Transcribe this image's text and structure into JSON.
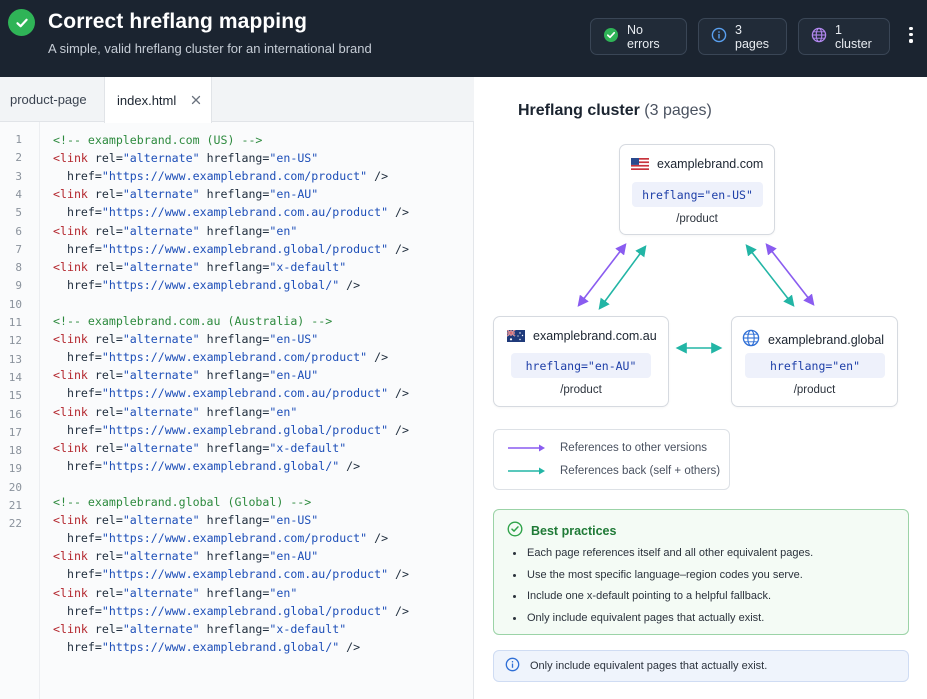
{
  "header": {
    "title": "Correct hreflang mapping",
    "subtitle": "A simple, valid hreflang cluster for an international brand",
    "badges": [
      {
        "label": "No errors",
        "icon": "check-circle-icon",
        "color": "#2fb457"
      },
      {
        "label": "3 pages",
        "icon": "info-icon",
        "color": "#5aa0f0"
      },
      {
        "label": "1 cluster",
        "icon": "globe-icon",
        "color": "#b388f0"
      }
    ]
  },
  "editor": {
    "tabs": [
      {
        "label": "product-page"
      },
      {
        "label": "index.html",
        "active": true
      }
    ],
    "line_numbers": [
      "1",
      "2",
      "3",
      "4",
      "5",
      "6",
      "7",
      "8",
      "9",
      "10",
      "11",
      "12",
      "13",
      "14",
      "15",
      "16",
      "17",
      "18",
      "19",
      "20",
      "21",
      "22"
    ],
    "lines": [
      [
        {
          "t": "<!-- examplebrand.com (US) -->",
          "c": "cm"
        }
      ],
      [
        {
          "t": "<link ",
          "c": "tg"
        },
        {
          "t": "rel=",
          "c": "at"
        },
        {
          "t": "\"alternate\"",
          "c": "st"
        },
        {
          "t": " hreflang=",
          "c": "at"
        },
        {
          "t": "\"en-US\"",
          "c": "st"
        }
      ],
      [
        {
          "t": "  href=",
          "c": "at"
        },
        {
          "t": "\"https://www.examplebrand.com/product\"",
          "c": "st"
        },
        {
          "t": " />",
          "c": "at"
        }
      ],
      [
        {
          "t": "<link ",
          "c": "tg"
        },
        {
          "t": "rel=",
          "c": "at"
        },
        {
          "t": "\"alternate\"",
          "c": "st"
        },
        {
          "t": " hreflang=",
          "c": "at"
        },
        {
          "t": "\"en-AU\"",
          "c": "st"
        }
      ],
      [
        {
          "t": "  href=",
          "c": "at"
        },
        {
          "t": "\"https://www.examplebrand.com.au/product\"",
          "c": "st"
        },
        {
          "t": " />",
          "c": "at"
        }
      ],
      [
        {
          "t": "<link ",
          "c": "tg"
        },
        {
          "t": "rel=",
          "c": "at"
        },
        {
          "t": "\"alternate\"",
          "c": "st"
        },
        {
          "t": " hreflang=",
          "c": "at"
        },
        {
          "t": "\"en\"",
          "c": "st"
        }
      ],
      [
        {
          "t": "  href=",
          "c": "at"
        },
        {
          "t": "\"https://www.examplebrand.global/product\"",
          "c": "st"
        },
        {
          "t": " />",
          "c": "at"
        }
      ],
      [
        {
          "t": "<link ",
          "c": "tg"
        },
        {
          "t": "rel=",
          "c": "at"
        },
        {
          "t": "\"alternate\"",
          "c": "st"
        },
        {
          "t": " hreflang=",
          "c": "at"
        },
        {
          "t": "\"x-default\"",
          "c": "st"
        }
      ],
      [
        {
          "t": "  href=",
          "c": "at"
        },
        {
          "t": "\"https://www.examplebrand.global/\"",
          "c": "st"
        },
        {
          "t": " />",
          "c": "at"
        }
      ],
      [],
      [
        {
          "t": "<!-- examplebrand.com.au (Australia) -->",
          "c": "cm"
        }
      ],
      [
        {
          "t": "<link ",
          "c": "tg"
        },
        {
          "t": "rel=",
          "c": "at"
        },
        {
          "t": "\"alternate\"",
          "c": "st"
        },
        {
          "t": " hreflang=",
          "c": "at"
        },
        {
          "t": "\"en-US\"",
          "c": "st"
        }
      ],
      [
        {
          "t": "  href=",
          "c": "at"
        },
        {
          "t": "\"https://www.examplebrand.com/product\"",
          "c": "st"
        },
        {
          "t": " />",
          "c": "at"
        }
      ],
      [
        {
          "t": "<link ",
          "c": "tg"
        },
        {
          "t": "rel=",
          "c": "at"
        },
        {
          "t": "\"alternate\"",
          "c": "st"
        },
        {
          "t": " hreflang=",
          "c": "at"
        },
        {
          "t": "\"en-AU\"",
          "c": "st"
        }
      ],
      [
        {
          "t": "  href=",
          "c": "at"
        },
        {
          "t": "\"https://www.examplebrand.com.au/product\"",
          "c": "st"
        },
        {
          "t": " />",
          "c": "at"
        }
      ],
      [
        {
          "t": "<link ",
          "c": "tg"
        },
        {
          "t": "rel=",
          "c": "at"
        },
        {
          "t": "\"alternate\"",
          "c": "st"
        },
        {
          "t": " hreflang=",
          "c": "at"
        },
        {
          "t": "\"en\"",
          "c": "st"
        }
      ],
      [
        {
          "t": "  href=",
          "c": "at"
        },
        {
          "t": "\"https://www.examplebrand.global/product\"",
          "c": "st"
        },
        {
          "t": " />",
          "c": "at"
        }
      ],
      [
        {
          "t": "<link ",
          "c": "tg"
        },
        {
          "t": "rel=",
          "c": "at"
        },
        {
          "t": "\"alternate\"",
          "c": "st"
        },
        {
          "t": " hreflang=",
          "c": "at"
        },
        {
          "t": "\"x-default\"",
          "c": "st"
        }
      ],
      [
        {
          "t": "  href=",
          "c": "at"
        },
        {
          "t": "\"https://www.examplebrand.global/\"",
          "c": "st"
        },
        {
          "t": " />",
          "c": "at"
        }
      ],
      [],
      [
        {
          "t": "<!-- examplebrand.global (Global) -->",
          "c": "cm"
        }
      ],
      [
        {
          "t": "<link ",
          "c": "tg"
        },
        {
          "t": "rel=",
          "c": "at"
        },
        {
          "t": "\"alternate\"",
          "c": "st"
        },
        {
          "t": " hreflang=",
          "c": "at"
        },
        {
          "t": "\"en-US\"",
          "c": "st"
        }
      ],
      [
        {
          "t": "  href=",
          "c": "at"
        },
        {
          "t": "\"https://www.examplebrand.com/product\"",
          "c": "st"
        },
        {
          "t": " />",
          "c": "at"
        }
      ],
      [
        {
          "t": "<link ",
          "c": "tg"
        },
        {
          "t": "rel=",
          "c": "at"
        },
        {
          "t": "\"alternate\"",
          "c": "st"
        },
        {
          "t": " hreflang=",
          "c": "at"
        },
        {
          "t": "\"en-AU\"",
          "c": "st"
        }
      ],
      [
        {
          "t": "  href=",
          "c": "at"
        },
        {
          "t": "\"https://www.examplebrand.com.au/product\"",
          "c": "st"
        },
        {
          "t": " />",
          "c": "at"
        }
      ],
      [
        {
          "t": "<link ",
          "c": "tg"
        },
        {
          "t": "rel=",
          "c": "at"
        },
        {
          "t": "\"alternate\"",
          "c": "st"
        },
        {
          "t": " hreflang=",
          "c": "at"
        },
        {
          "t": "\"en\"",
          "c": "st"
        }
      ],
      [
        {
          "t": "  href=",
          "c": "at"
        },
        {
          "t": "\"https://www.examplebrand.global/product\"",
          "c": "st"
        },
        {
          "t": " />",
          "c": "at"
        }
      ],
      [
        {
          "t": "<link ",
          "c": "tg"
        },
        {
          "t": "rel=",
          "c": "at"
        },
        {
          "t": "\"alternate\"",
          "c": "st"
        },
        {
          "t": " hreflang=",
          "c": "at"
        },
        {
          "t": "\"x-default\"",
          "c": "st"
        }
      ],
      [
        {
          "t": "  href=",
          "c": "at"
        },
        {
          "t": "\"https://www.examplebrand.global/\"",
          "c": "st"
        },
        {
          "t": " />",
          "c": "at"
        }
      ]
    ]
  },
  "cluster": {
    "title": "Hreflang cluster",
    "count": "(3 pages)",
    "nodes": {
      "us": {
        "domain": "examplebrand.com",
        "hreflang": "hreflang=\"en-US\"",
        "path": "/product",
        "icon": "us-flag-icon"
      },
      "au": {
        "domain": "examplebrand.com.au",
        "hreflang": "hreflang=\"en-AU\"",
        "path": "/product",
        "icon": "au-flag-icon"
      },
      "global": {
        "domain": "examplebrand.global",
        "hreflang": "hreflang=\"en\"",
        "path": "/product",
        "icon": "globe-icon"
      }
    },
    "colors": {
      "references": "#8a5cf0",
      "back": "#22b5a5"
    }
  },
  "legend": {
    "items": [
      {
        "label": "References to other versions",
        "color": "#8a5cf0"
      },
      {
        "label": "References back (self + others)",
        "color": "#22b5a5"
      }
    ]
  },
  "best_practices": {
    "title": "Best practices",
    "items": [
      "Each page references itself and all other equivalent pages.",
      "Use the most specific language–region codes you serve.",
      "Include one x-default pointing to a helpful fallback.",
      "Only include equivalent pages that actually exist."
    ]
  },
  "info": {
    "text": "Only include equivalent pages that actually exist."
  }
}
